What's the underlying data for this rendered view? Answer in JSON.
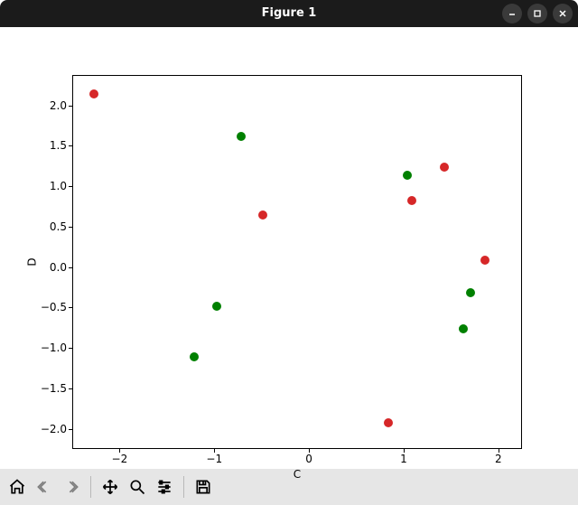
{
  "window": {
    "title": "Figure 1"
  },
  "chart_data": {
    "type": "scatter",
    "title": "",
    "xlabel": "C",
    "ylabel": "D",
    "xlim": [
      -2.5,
      2.25
    ],
    "ylim": [
      -2.25,
      2.375
    ],
    "xticks": [
      -2,
      -1,
      0,
      1,
      2
    ],
    "yticks": [
      -2.0,
      -1.5,
      -1.0,
      -0.5,
      0.0,
      0.5,
      1.0,
      1.5,
      2.0
    ],
    "xtick_labels": [
      "−2",
      "−1",
      "0",
      "1",
      "2"
    ],
    "ytick_labels": [
      "−2.0",
      "−1.5",
      "−1.0",
      "−0.5",
      "0.0",
      "0.5",
      "1.0",
      "1.5",
      "2.0"
    ],
    "series": [
      {
        "name": "green",
        "color": "#008000",
        "points": [
          {
            "x": -0.73,
            "y": 1.63
          },
          {
            "x": 1.03,
            "y": 1.15
          },
          {
            "x": 1.7,
            "y": -0.31
          },
          {
            "x": -0.98,
            "y": -0.47
          },
          {
            "x": 1.62,
            "y": -0.75
          },
          {
            "x": -1.22,
            "y": -1.1
          }
        ]
      },
      {
        "name": "red",
        "color": "#d62728",
        "points": [
          {
            "x": -2.28,
            "y": 2.15
          },
          {
            "x": 1.42,
            "y": 1.25
          },
          {
            "x": 1.08,
            "y": 0.83
          },
          {
            "x": -0.5,
            "y": 0.65
          },
          {
            "x": 1.85,
            "y": 0.1
          },
          {
            "x": 0.83,
            "y": -1.92
          }
        ]
      }
    ]
  },
  "toolbar": {
    "items": [
      {
        "name": "home-icon",
        "interactable": true
      },
      {
        "name": "back-icon",
        "interactable": false
      },
      {
        "name": "forward-icon",
        "interactable": false
      },
      {
        "name": "pan-icon",
        "interactable": true
      },
      {
        "name": "zoom-icon",
        "interactable": true
      },
      {
        "name": "configure-icon",
        "interactable": true
      },
      {
        "name": "save-icon",
        "interactable": true
      }
    ]
  }
}
